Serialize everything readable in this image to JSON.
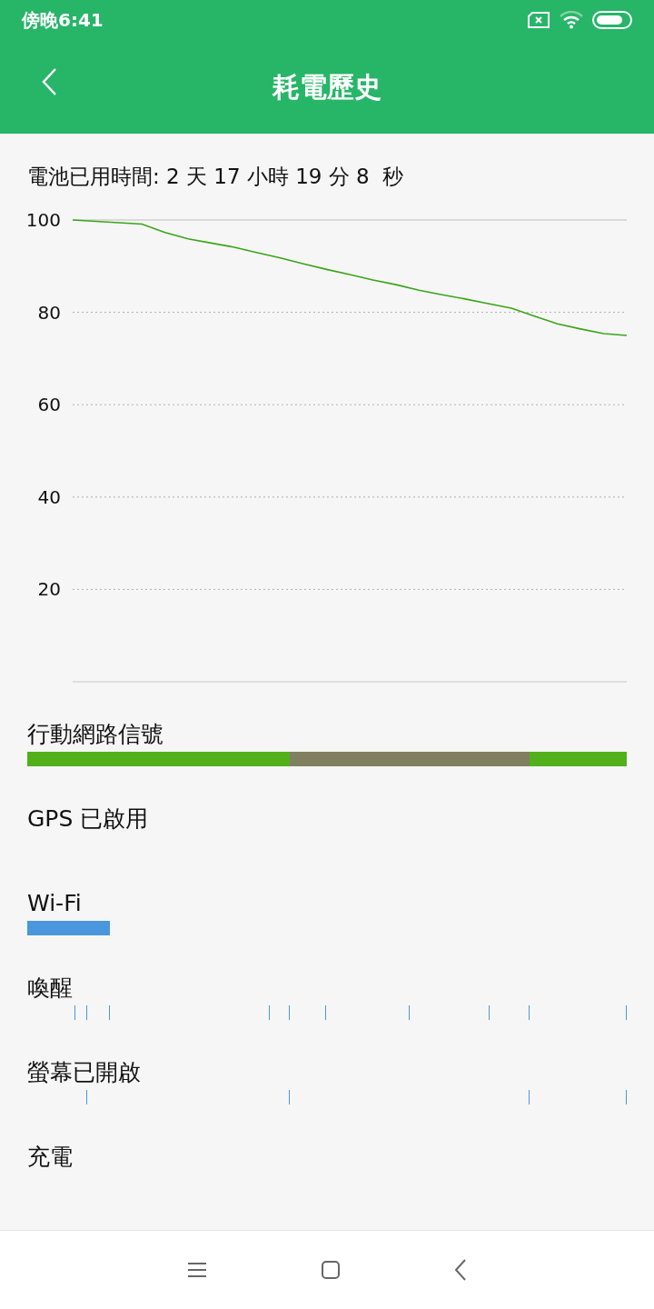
{
  "status_bar": {
    "time": "傍晚6:41"
  },
  "header": {
    "title": "耗電歷史"
  },
  "uptime": "電池已用時間: 2 天 17 小時 19 分 8  秒",
  "chart_data": {
    "type": "line",
    "grid": true,
    "series": [
      {
        "color": "#3aa517",
        "values": [
          100,
          99.7,
          99.4,
          99.1,
          97.3,
          95.9,
          95,
          94.1,
          92.9,
          91.8,
          90.5,
          89.3,
          88.2,
          87,
          86,
          84.8,
          83.8,
          82.9,
          81.9,
          80.9,
          79.2,
          77.5,
          76.4,
          75.4,
          75
        ]
      }
    ],
    "ylim": [
      0,
      100
    ],
    "yticks": [
      20,
      40,
      60,
      80,
      100
    ]
  },
  "rows": [
    {
      "label": "行動網路信號",
      "kind": "bar",
      "segments": [
        {
          "color": "#52b01a"
        },
        {
          "color": "#807f60"
        },
        {
          "color": "#52b01a"
        }
      ]
    },
    {
      "label": "GPS 已啟用",
      "kind": "none"
    },
    {
      "label": "Wi-Fi",
      "kind": "bar",
      "segments": [
        {
          "color": "#4a97dd"
        }
      ]
    },
    {
      "label": "喚醒",
      "kind": "ticks"
    },
    {
      "label": "螢幕已開啟",
      "kind": "ticks"
    },
    {
      "label": "充電",
      "kind": "none"
    }
  ]
}
